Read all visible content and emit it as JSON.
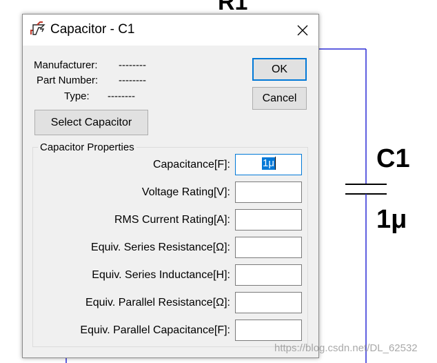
{
  "schematic": {
    "r1_label": "R1",
    "c1_label": "C1",
    "c1_value": "1μ",
    "wire_color": "#2a2ad6"
  },
  "dialog": {
    "title": "Capacitor - C1",
    "icon": "ltspice-icon",
    "info": {
      "manufacturer_label": "Manufacturer:",
      "manufacturer_value": "--------",
      "part_number_label": "Part Number:",
      "part_number_value": "--------",
      "type_label": "Type:",
      "type_value": "--------"
    },
    "buttons": {
      "ok": "OK",
      "cancel": "Cancel",
      "select": "Select Capacitor"
    },
    "group": {
      "title": "Capacitor Properties",
      "fields": [
        {
          "label": "Capacitance[F]:",
          "value": "1μ"
        },
        {
          "label": "Voltage Rating[V]:",
          "value": ""
        },
        {
          "label": "RMS Current Rating[A]:",
          "value": ""
        },
        {
          "label": "Equiv. Series Resistance[Ω]:",
          "value": ""
        },
        {
          "label": "Equiv. Series Inductance[H]:",
          "value": ""
        },
        {
          "label": "Equiv. Parallel Resistance[Ω]:",
          "value": ""
        },
        {
          "label": "Equiv. Parallel Capacitance[F]:",
          "value": ""
        }
      ]
    },
    "accent_color": "#0078d7"
  },
  "watermark": "https://blog.csdn.net/DL_62532"
}
